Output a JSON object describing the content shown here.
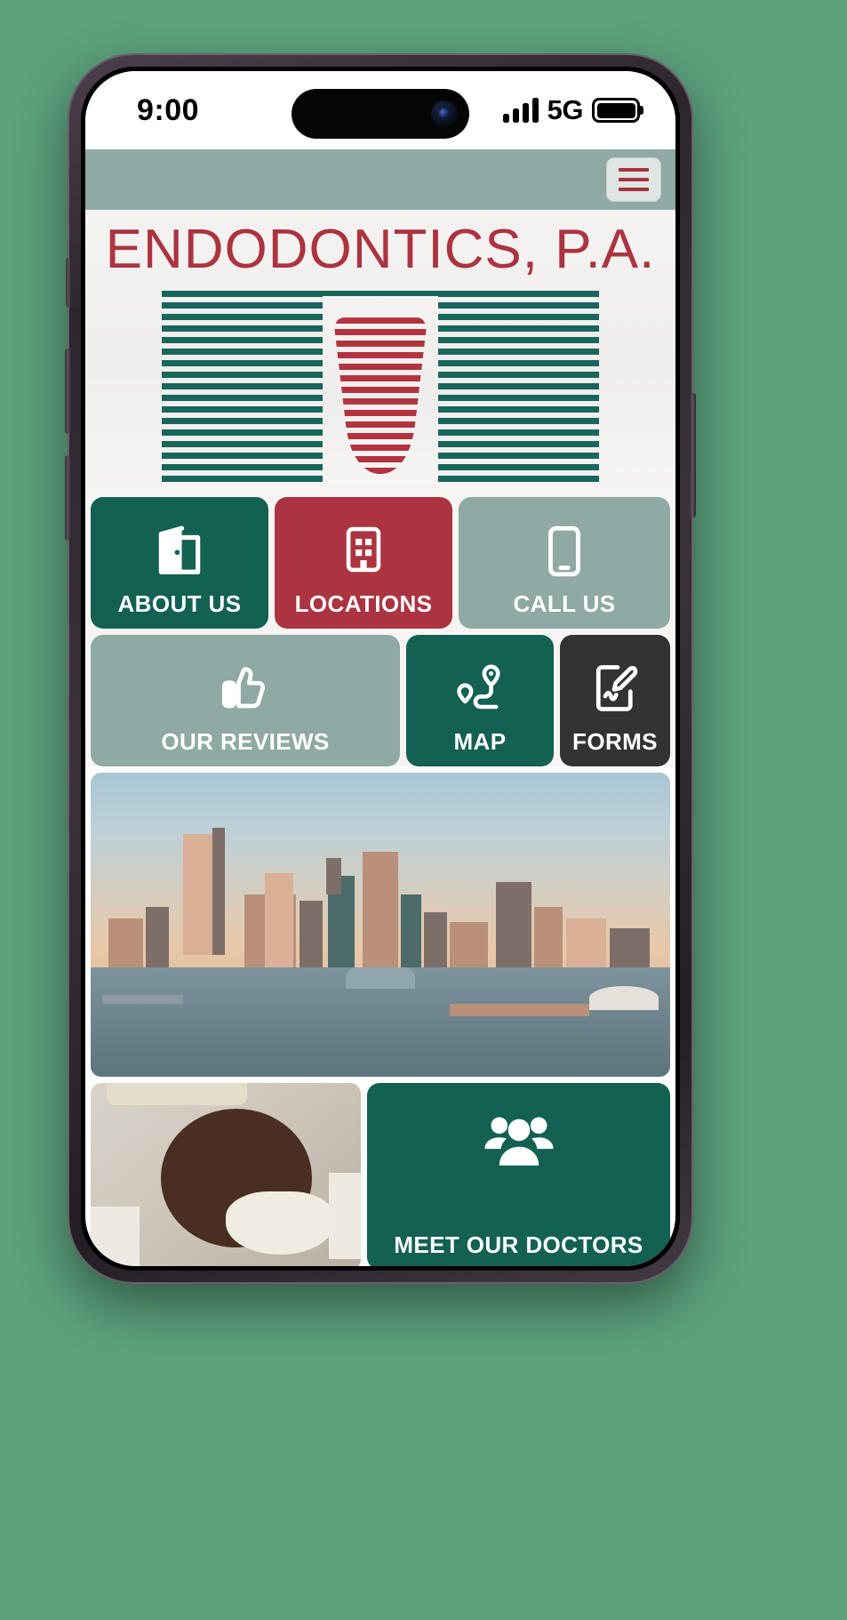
{
  "device": {
    "statusbar": {
      "clock": "9:00",
      "network": "5G",
      "signal_icon": "signal-bars-icon",
      "battery_icon": "battery-full-icon",
      "dynamic_island": "dynamic-island"
    }
  },
  "app": {
    "header": {
      "menu_icon": "hamburger-menu-icon",
      "background_color": "#8fa9a4"
    },
    "logo": {
      "title": "ENDODONTICS, P.A.",
      "title_color": "#ab3440",
      "mark_icon": "striped-tooth-logo-icon",
      "stripe_color": "#18665c",
      "tooth_color": "#b3333f"
    },
    "tiles": [
      {
        "label": "ABOUT US",
        "icon": "open-door-icon",
        "color": "#136152",
        "width": 2
      },
      {
        "label": "LOCATIONS",
        "icon": "building-icon",
        "color": "#ab3440",
        "width": 2
      },
      {
        "label": "CALL US",
        "icon": "mobile-phone-icon",
        "color": "#8fa9a4",
        "width": 3
      },
      {
        "label": "OUR REVIEWS",
        "icon": "thumbs-up-icon",
        "color": "#8fa9a4",
        "width": 3
      },
      {
        "label": "MAP",
        "icon": "route-pins-icon",
        "color": "#136152",
        "width": 2
      },
      {
        "label": "FORMS",
        "icon": "document-signature-icon",
        "color": "#333333",
        "width": 2
      }
    ],
    "media": {
      "skyline_photo": "baltimore-inner-harbor-skyline-photo",
      "dentist_photo": "dentist-with-mask-photo",
      "monitor_photo": "staff-at-xray-monitor-photo"
    },
    "doctors_tile": {
      "label": "MEET OUR DOCTORS",
      "icon": "group-of-people-icon",
      "color": "#136152"
    }
  }
}
